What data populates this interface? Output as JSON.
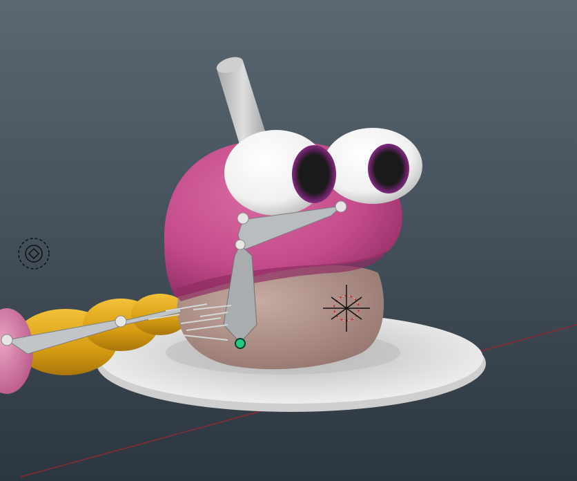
{
  "viewport": {
    "background_top": "#5a6873",
    "background_bottom": "#2c3640",
    "grid_axis_color": "#8a2a33"
  },
  "scene": {
    "character": {
      "body_color": "#c44b8a",
      "body_shadow": "#8f2d63",
      "lower_body_color": "#b89990",
      "eye_white": "#f4f4f4",
      "iris_color": "#7a2870",
      "pupil_color": "#1a1a1a",
      "antenna_color": "#c9c9c9"
    },
    "plate_color": "#dedede",
    "tail_color": "#e2aa18",
    "tail_tip_color": "#d77aa6"
  },
  "rig": {
    "bone_color": "#b9bdbf",
    "joint_color": "#e6e6e6",
    "selected_joint_color": "#22c981"
  },
  "icons": {
    "manipulator": "manipulator-icon",
    "locator": "target-locator-icon"
  }
}
